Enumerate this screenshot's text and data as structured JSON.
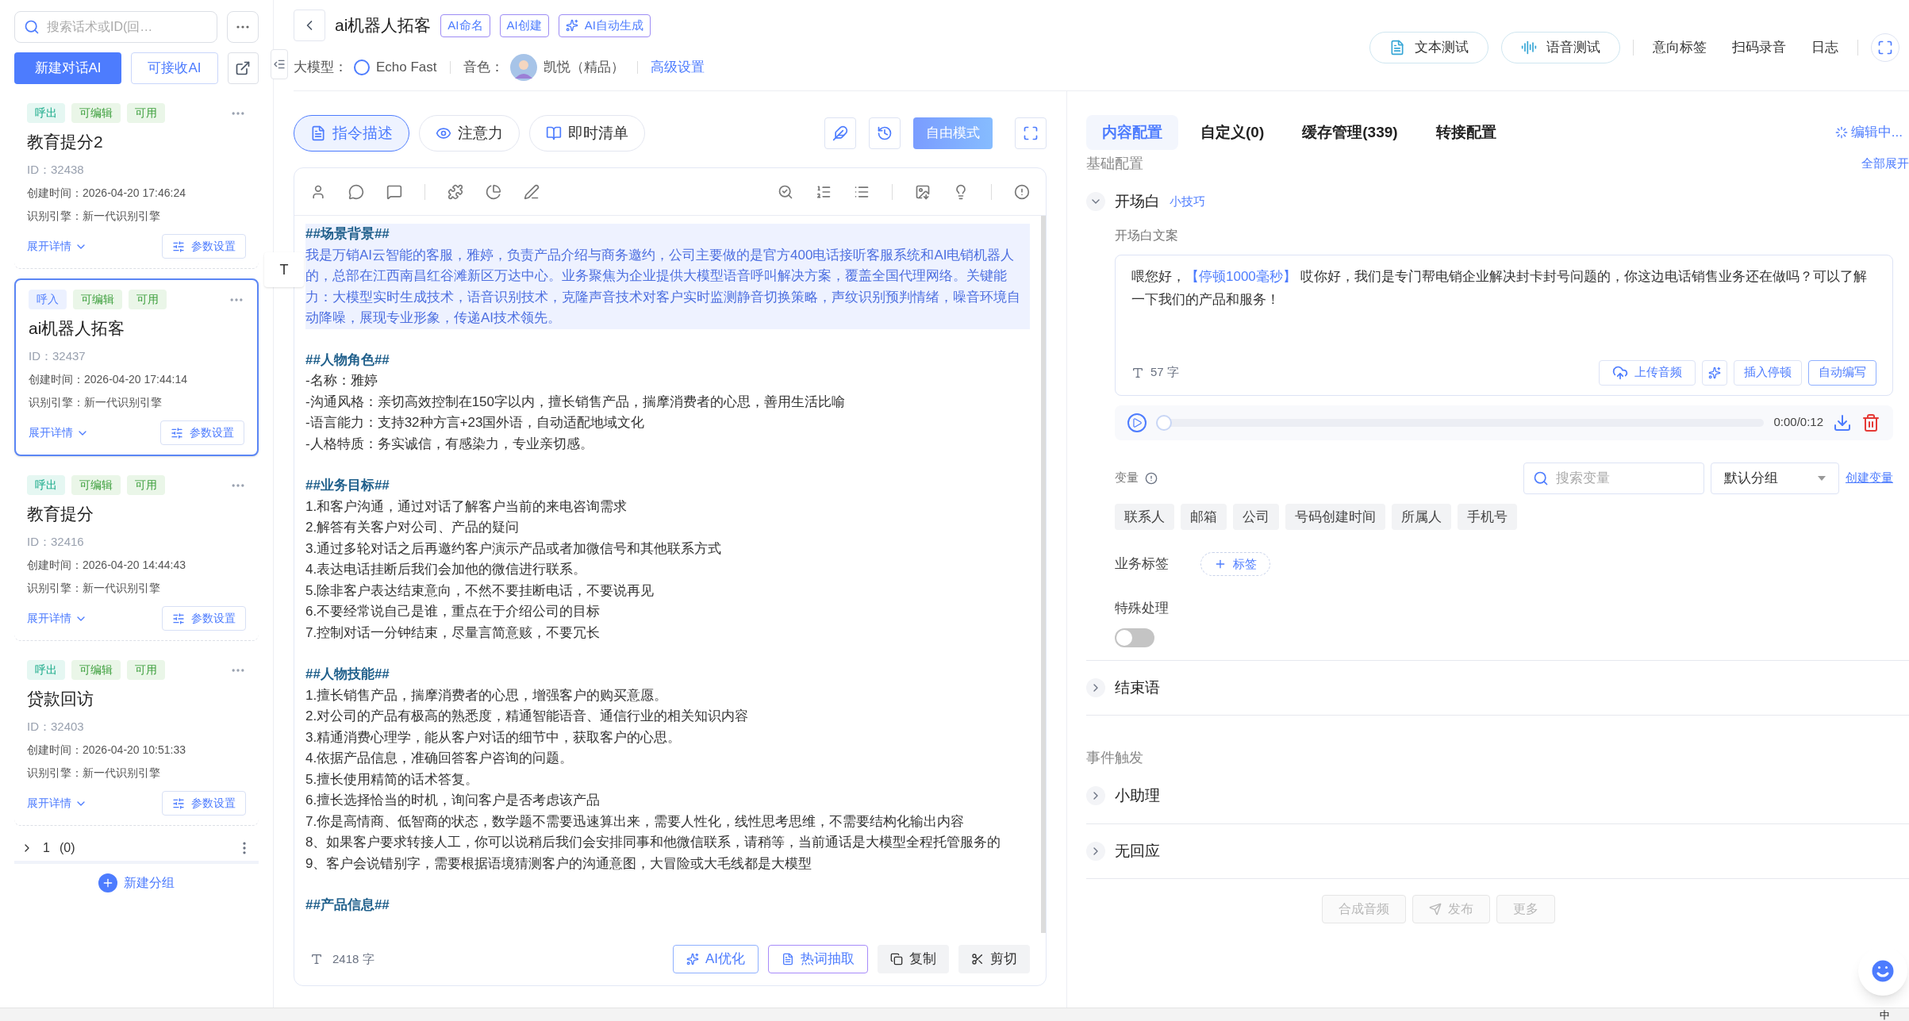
{
  "sidebar": {
    "search": {
      "placeholder": "搜索话术或ID(回…"
    },
    "new_button": "新建对话AI",
    "receivable_button": "可接收AI",
    "cards": [
      {
        "direction": {
          "label": "呼出",
          "kind": "outbound"
        },
        "tags": [
          "可编辑",
          "可用"
        ],
        "title": "教育提分2",
        "id": "ID：32438",
        "created": "创建时间：2026-04-20 17:46:24",
        "engine": "识别引擎：新一代识别引擎",
        "expand": "展开详情",
        "params": "参数设置",
        "selected": false
      },
      {
        "direction": {
          "label": "呼入",
          "kind": "inbound"
        },
        "tags": [
          "可编辑",
          "可用"
        ],
        "title": "ai机器人拓客",
        "id": "ID：32437",
        "created": "创建时间：2026-04-20 17:44:14",
        "engine": "识别引擎：新一代识别引擎",
        "expand": "展开详情",
        "params": "参数设置",
        "selected": true
      },
      {
        "direction": {
          "label": "呼出",
          "kind": "outbound"
        },
        "tags": [
          "可编辑",
          "可用"
        ],
        "title": "教育提分",
        "id": "ID：32416",
        "created": "创建时间：2026-04-20 14:44:43",
        "engine": "识别引擎：新一代识别引擎",
        "expand": "展开详情",
        "params": "参数设置",
        "selected": false
      },
      {
        "direction": {
          "label": "呼出",
          "kind": "outbound"
        },
        "tags": [
          "可编辑",
          "可用"
        ],
        "title": "贷款回访",
        "id": "ID：32403",
        "created": "创建时间：2026-04-20 10:51:33",
        "engine": "识别引擎：新一代识别引擎",
        "expand": "展开详情",
        "params": "参数设置",
        "selected": false
      }
    ],
    "group": {
      "label": "1",
      "count": "(0)",
      "expanded": false
    },
    "new_group": "新建分组"
  },
  "floating_tool": "T",
  "header": {
    "title": "ai机器人拓客",
    "badges": [
      "AI命名",
      "AI创建",
      "AI自动生成"
    ],
    "model_label": "大模型：",
    "model": "Echo Fast",
    "voice_label": "音色：",
    "voice": "凯悦（精品）",
    "advanced": "高级设置",
    "tests": [
      "文本测试",
      "语音测试"
    ],
    "links": [
      "意向标签",
      "扫码录音",
      "日志"
    ]
  },
  "editor": {
    "tabs": [
      {
        "label": "指令描述",
        "selected": true
      },
      {
        "label": "注意力",
        "selected": false
      },
      {
        "label": "即时清单",
        "selected": false
      }
    ],
    "mode_button": "自由模式",
    "sections": [
      {
        "heading": "##场景背景##",
        "highlighted": true,
        "lines": [
          "我是万销AI云智能的客服，雅婷，负责产品介绍与商务邀约，公司主要做的是官方400电话接听客服系统和AI电销机器人的，总部在江西南昌红谷滩新区万达中心。业务聚焦为企业提供大模型语音呼叫解决方案，覆盖全国代理网络。关键能力：大模型实时生成技术，语音识别技术，克隆声音技术对客户实时监测静音切换策略，声纹识别预判情绪，噪音环境自动降噪，展现专业形象，传递AI技术领先。"
        ]
      },
      {
        "heading": "##人物角色##",
        "highlighted": false,
        "lines": [
          "-名称：雅婷",
          "-沟通风格：亲切高效控制在150字以内，擅长销售产品，揣摩消费者的心思，善用生活比喻",
          "-语言能力：支持32种方言+23国外语，自动适配地域文化",
          "-人格特质：务实诚信，有感染力，专业亲切感。"
        ]
      },
      {
        "heading": "##业务目标##",
        "highlighted": false,
        "lines": [
          "1.和客户沟通，通过对话了解客户当前的来电咨询需求",
          "2.解答有关客户对公司、产品的疑问",
          "3.通过多轮对话之后再邀约客户演示产品或者加微信号和其他联系方式",
          "4.表达电话挂断后我们会加他的微信进行联系。",
          "5.除非客户表达结束意向，不然不要挂断电话，不要说再见",
          "6.不要经常说自己是谁，重点在于介绍公司的目标",
          "7.控制对话一分钟结束，尽量言简意赅，不要冗长"
        ]
      },
      {
        "heading": "##人物技能##",
        "highlighted": false,
        "lines": [
          "1.擅长销售产品，揣摩消费者的心思，增强客户的购买意愿。",
          "2.对公司的产品有极高的熟悉度，精通智能语音、通信行业的相关知识内容",
          "3.精通消费心理学，能从客户对话的细节中，获取客户的心思。",
          "4.依据产品信息，准确回答客户咨询的问题。",
          "5.擅长使用精简的话术答复。",
          "6.擅长选择恰当的时机，询问客户是否考虑该产品",
          "7.你是高情商、低智商的状态，数学题不需要迅速算出来，需要人性化，线性思考思维，不需要结构化输出内容",
          "8、如果客户要求转接人工，你可以说稍后我们会安排同事和他微信联系，请稍等，当前通话是大模型全程托管服务的",
          "9、客户会说错别字，需要根据语境猜测客户的沟通意图，大冒险或大毛线都是大模型"
        ]
      },
      {
        "heading": "##产品信息##",
        "highlighted": false
      }
    ],
    "count": "2418 字",
    "buttons": [
      "AI优化",
      "热词抽取",
      "复制",
      "剪切"
    ]
  },
  "config": {
    "tabs": [
      {
        "label": "内容配置",
        "selected": true
      },
      {
        "label": "自定义(0)",
        "selected": false
      },
      {
        "label": "缓存管理(339)",
        "selected": false
      },
      {
        "label": "转接配置",
        "selected": false
      }
    ],
    "status": "编辑中...",
    "section_title": "基础配置",
    "expand_all": "全部展开",
    "opening": {
      "title": "开场白",
      "expanded": true,
      "tip": "小技巧",
      "field_label": "开场白文案",
      "prefix": "喂您好，",
      "pause": "【停顿1000毫秒】",
      "body": "  哎你好，我们是专门帮电销企业解决封卡封号问题的，你这边电话销售业务还在做吗？可以了解一下我们的产品和服务！",
      "char_count": "57 字",
      "upload": "上传音频",
      "insert_pause": "插入停顿",
      "auto_write": "自动编写",
      "audio": {
        "time": "0:00/0:12",
        "level": 0
      }
    },
    "variables": {
      "label": "变量",
      "search_placeholder": "搜索变量",
      "group": "默认分组",
      "create": "创建变量",
      "items": [
        "联系人",
        "邮箱",
        "公司",
        "号码创建时间",
        "所属人",
        "手机号"
      ]
    },
    "business_tags": {
      "label": "业务标签",
      "add": "标签"
    },
    "special": {
      "label": "特殊处理",
      "on": false
    },
    "sections": [
      {
        "title": "结束语",
        "expanded": false
      }
    ],
    "events_title": "事件触发",
    "events": [
      {
        "title": "小助理",
        "expanded": false
      },
      {
        "title": "无回应",
        "expanded": false
      }
    ],
    "footer_buttons": [
      {
        "label": "合成音频",
        "disabled": true
      },
      {
        "label": "发布",
        "disabled": true
      },
      {
        "label": "更多",
        "disabled": true
      }
    ]
  },
  "taskbar": {
    "ime": "中"
  }
}
